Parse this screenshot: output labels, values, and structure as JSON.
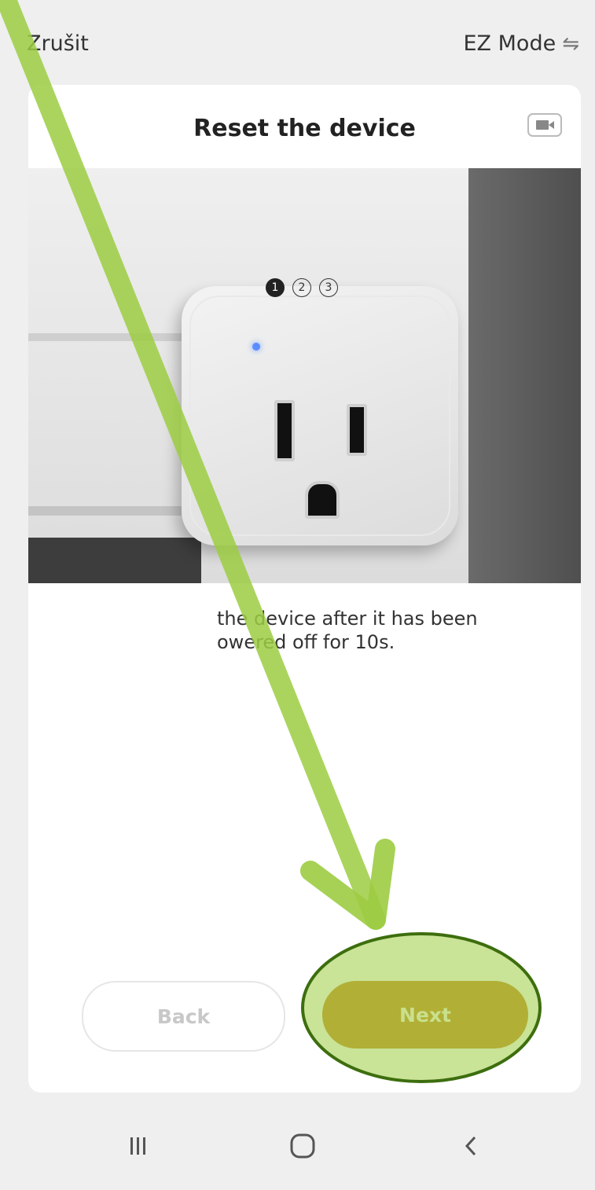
{
  "topbar": {
    "cancel_label": "Zrušit",
    "mode_label": "EZ Mode",
    "mode_icon": "swap-icon"
  },
  "card": {
    "title": "Reset the device",
    "video_icon": "video-camera-icon",
    "steps": [
      "1",
      "2",
      "3"
    ],
    "active_step": 1,
    "description_line1": "the device after it has been",
    "description_line2": "owered off for 10s."
  },
  "buttons": {
    "back_label": "Back",
    "next_label": "Next"
  },
  "colors": {
    "accent": "#c98d28",
    "annotation_green": "#9ccc42"
  },
  "navbar": {
    "recent_icon": "recent-apps-icon",
    "home_icon": "home-icon",
    "back_icon": "back-icon"
  }
}
